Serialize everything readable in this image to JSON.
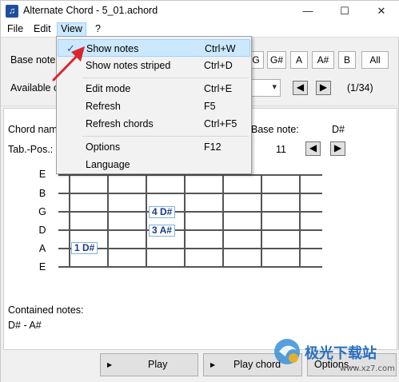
{
  "window": {
    "title": "Alternate Chord - 5_01.achord",
    "minimize_glyph": "—",
    "maximize_glyph": "☐",
    "close_glyph": "✕",
    "app_icon_glyph": "♫"
  },
  "menubar": {
    "file": "File",
    "edit": "Edit",
    "view": "View",
    "help": "?"
  },
  "toolbar": {
    "base_note_label": "Base note",
    "available_label": "Available c",
    "note_buttons": [
      "G",
      "G#",
      "A",
      "A#",
      "B",
      "All"
    ],
    "page_counter": "(1/34)",
    "prev_glyph": "◀",
    "next_glyph": "▶",
    "combo_arrow": "▾"
  },
  "chord_panel": {
    "chord_name_label": "Chord nam",
    "tab_pos_label": "Tab.-Pos.:",
    "base_note_label": "Base note:",
    "base_note_value": "D#",
    "position_value": "11",
    "strings": [
      "E",
      "B",
      "G",
      "D",
      "A",
      "E"
    ],
    "markers": [
      {
        "label": "4 D#",
        "string": "G",
        "fret": 3
      },
      {
        "label": "3 A#",
        "string": "D",
        "fret": 3
      },
      {
        "label": "1 D#",
        "string": "A",
        "fret": 1
      }
    ],
    "contained_notes_label": "Contained notes:",
    "contained_notes_value": "D# - A#"
  },
  "bottom": {
    "play_label": "Play",
    "play_chord_label": "Play chord",
    "options_label": "Options..."
  },
  "view_menu": {
    "items": [
      {
        "label": "Show notes",
        "shortcut": "Ctrl+W",
        "checked": true,
        "highlighted": true
      },
      {
        "label": "Show notes striped",
        "shortcut": "Ctrl+D"
      },
      {
        "label": "Edit mode",
        "shortcut": "Ctrl+E"
      },
      {
        "label": "Refresh",
        "shortcut": "F5"
      },
      {
        "label": "Refresh chords",
        "shortcut": "Ctrl+F5"
      },
      {
        "label": "Options",
        "shortcut": "F12"
      },
      {
        "label": "Language",
        "shortcut": ""
      }
    ],
    "check_glyph": "✓"
  },
  "watermark": {
    "text_cn": "极光下载站",
    "text_url": "www.xz7.com"
  },
  "colors": {
    "accent": "#cce8ff",
    "marker_text": "#1a3a8a",
    "arrow": "#d9262c"
  }
}
